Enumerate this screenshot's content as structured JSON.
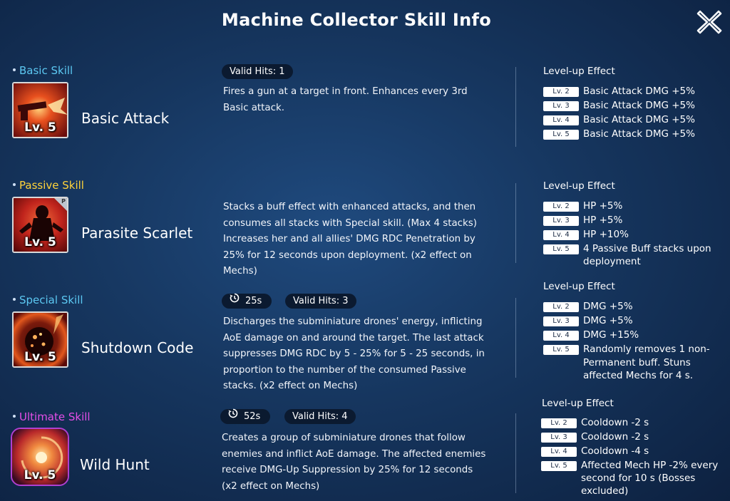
{
  "header": {
    "title": "Machine Collector Skill Info",
    "close_icon": "close-x-icon"
  },
  "level_badge": "Lv. 5",
  "passive_mark": "P",
  "colors": {
    "basic": "#5cc8f2",
    "passive": "#ffd33a",
    "special": "#5cc8f2",
    "ultimate": "#e44ee8"
  },
  "skills": [
    {
      "category": "Basic Skill",
      "name": "Basic Attack",
      "valid_hits": "Valid Hits: 1",
      "description": "Fires a gun at a target in front. Enhances every 3rd Basic attack.",
      "levelup_title": "Level-up Effect",
      "levels": [
        {
          "tag": "Lv. 2",
          "text": "Basic Attack DMG +5%"
        },
        {
          "tag": "Lv. 3",
          "text": "Basic Attack DMG +5%"
        },
        {
          "tag": "Lv. 4",
          "text": "Basic Attack DMG +5%"
        },
        {
          "tag": "Lv. 5",
          "text": "Basic Attack DMG +5%"
        }
      ]
    },
    {
      "category": "Passive Skill",
      "name": "Parasite Scarlet",
      "description": "Stacks a buff effect with enhanced attacks, and then consumes all stacks with Special skill. (Max 4 stacks) Increases her and all allies' DMG RDC Penetration by 25% for 12 seconds upon deployment. (x2 effect on Mechs)",
      "levelup_title": "Level-up Effect",
      "levels": [
        {
          "tag": "Lv. 2",
          "text": "HP +5%"
        },
        {
          "tag": "Lv. 3",
          "text": "HP +5%"
        },
        {
          "tag": "Lv. 4",
          "text": "HP +10%"
        },
        {
          "tag": "Lv. 5",
          "text": "4 Passive Buff stacks upon deployment"
        }
      ]
    },
    {
      "category": "Special Skill",
      "name": "Shutdown Code",
      "cooldown": "25s",
      "valid_hits": "Valid Hits: 3",
      "description": "Discharges the subminiature drones' energy, inflicting AoE damage on and around the target. The last attack suppresses DMG RDC by 5 - 25% for 5 - 25 seconds, in proportion to the number of the consumed Passive stacks. (x2 effect on Mechs)",
      "levelup_title": "Level-up Effect",
      "levels": [
        {
          "tag": "Lv. 2",
          "text": "DMG +5%"
        },
        {
          "tag": "Lv. 3",
          "text": "DMG +5%"
        },
        {
          "tag": "Lv. 4",
          "text": "DMG +15%"
        },
        {
          "tag": "Lv. 5",
          "text": "Randomly removes 1 non-Permanent buff. Stuns affected Mechs for 4 s."
        }
      ]
    },
    {
      "category": "Ultimate Skill",
      "name": "Wild Hunt",
      "cooldown": "52s",
      "valid_hits": "Valid Hits: 4",
      "description": "Creates a group of subminiature drones that follow enemies and inflict AoE damage. The affected enemies receive DMG-Up Suppression by 25% for 12 seconds (x2 effect on Mechs)",
      "levelup_title": "Level-up Effect",
      "levels": [
        {
          "tag": "Lv. 2",
          "text": "Cooldown -2 s"
        },
        {
          "tag": "Lv. 3",
          "text": "Cooldown -2 s"
        },
        {
          "tag": "Lv. 4",
          "text": "Cooldown -4 s"
        },
        {
          "tag": "Lv. 5",
          "text": "Affected Mech HP -2% every second for 10 s (Bosses excluded)"
        }
      ]
    }
  ]
}
